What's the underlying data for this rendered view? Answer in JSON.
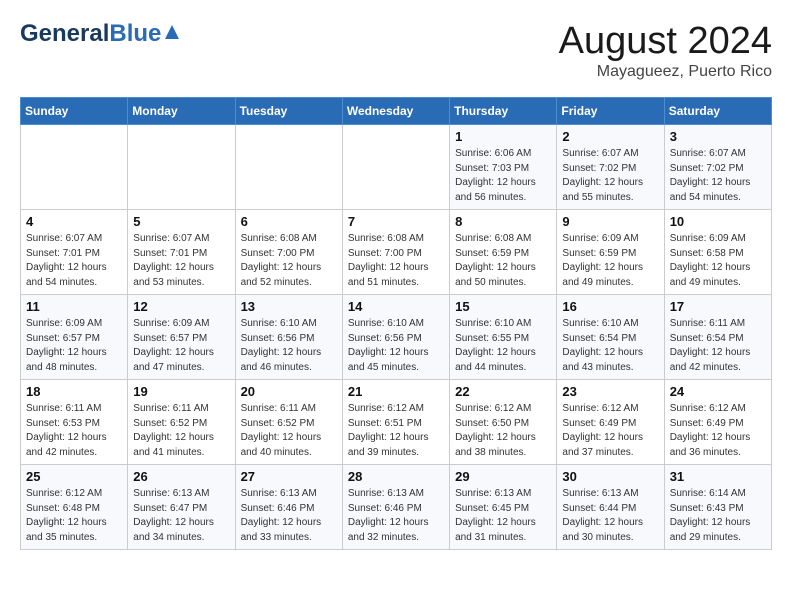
{
  "header": {
    "logo_general": "General",
    "logo_blue": "Blue",
    "month": "August 2024",
    "location": "Mayagueez, Puerto Rico"
  },
  "days_of_week": [
    "Sunday",
    "Monday",
    "Tuesday",
    "Wednesday",
    "Thursday",
    "Friday",
    "Saturday"
  ],
  "weeks": [
    [
      {
        "day": "",
        "info": ""
      },
      {
        "day": "",
        "info": ""
      },
      {
        "day": "",
        "info": ""
      },
      {
        "day": "",
        "info": ""
      },
      {
        "day": "1",
        "info": "Sunrise: 6:06 AM\nSunset: 7:03 PM\nDaylight: 12 hours\nand 56 minutes."
      },
      {
        "day": "2",
        "info": "Sunrise: 6:07 AM\nSunset: 7:02 PM\nDaylight: 12 hours\nand 55 minutes."
      },
      {
        "day": "3",
        "info": "Sunrise: 6:07 AM\nSunset: 7:02 PM\nDaylight: 12 hours\nand 54 minutes."
      }
    ],
    [
      {
        "day": "4",
        "info": "Sunrise: 6:07 AM\nSunset: 7:01 PM\nDaylight: 12 hours\nand 54 minutes."
      },
      {
        "day": "5",
        "info": "Sunrise: 6:07 AM\nSunset: 7:01 PM\nDaylight: 12 hours\nand 53 minutes."
      },
      {
        "day": "6",
        "info": "Sunrise: 6:08 AM\nSunset: 7:00 PM\nDaylight: 12 hours\nand 52 minutes."
      },
      {
        "day": "7",
        "info": "Sunrise: 6:08 AM\nSunset: 7:00 PM\nDaylight: 12 hours\nand 51 minutes."
      },
      {
        "day": "8",
        "info": "Sunrise: 6:08 AM\nSunset: 6:59 PM\nDaylight: 12 hours\nand 50 minutes."
      },
      {
        "day": "9",
        "info": "Sunrise: 6:09 AM\nSunset: 6:59 PM\nDaylight: 12 hours\nand 49 minutes."
      },
      {
        "day": "10",
        "info": "Sunrise: 6:09 AM\nSunset: 6:58 PM\nDaylight: 12 hours\nand 49 minutes."
      }
    ],
    [
      {
        "day": "11",
        "info": "Sunrise: 6:09 AM\nSunset: 6:57 PM\nDaylight: 12 hours\nand 48 minutes."
      },
      {
        "day": "12",
        "info": "Sunrise: 6:09 AM\nSunset: 6:57 PM\nDaylight: 12 hours\nand 47 minutes."
      },
      {
        "day": "13",
        "info": "Sunrise: 6:10 AM\nSunset: 6:56 PM\nDaylight: 12 hours\nand 46 minutes."
      },
      {
        "day": "14",
        "info": "Sunrise: 6:10 AM\nSunset: 6:56 PM\nDaylight: 12 hours\nand 45 minutes."
      },
      {
        "day": "15",
        "info": "Sunrise: 6:10 AM\nSunset: 6:55 PM\nDaylight: 12 hours\nand 44 minutes."
      },
      {
        "day": "16",
        "info": "Sunrise: 6:10 AM\nSunset: 6:54 PM\nDaylight: 12 hours\nand 43 minutes."
      },
      {
        "day": "17",
        "info": "Sunrise: 6:11 AM\nSunset: 6:54 PM\nDaylight: 12 hours\nand 42 minutes."
      }
    ],
    [
      {
        "day": "18",
        "info": "Sunrise: 6:11 AM\nSunset: 6:53 PM\nDaylight: 12 hours\nand 42 minutes."
      },
      {
        "day": "19",
        "info": "Sunrise: 6:11 AM\nSunset: 6:52 PM\nDaylight: 12 hours\nand 41 minutes."
      },
      {
        "day": "20",
        "info": "Sunrise: 6:11 AM\nSunset: 6:52 PM\nDaylight: 12 hours\nand 40 minutes."
      },
      {
        "day": "21",
        "info": "Sunrise: 6:12 AM\nSunset: 6:51 PM\nDaylight: 12 hours\nand 39 minutes."
      },
      {
        "day": "22",
        "info": "Sunrise: 6:12 AM\nSunset: 6:50 PM\nDaylight: 12 hours\nand 38 minutes."
      },
      {
        "day": "23",
        "info": "Sunrise: 6:12 AM\nSunset: 6:49 PM\nDaylight: 12 hours\nand 37 minutes."
      },
      {
        "day": "24",
        "info": "Sunrise: 6:12 AM\nSunset: 6:49 PM\nDaylight: 12 hours\nand 36 minutes."
      }
    ],
    [
      {
        "day": "25",
        "info": "Sunrise: 6:12 AM\nSunset: 6:48 PM\nDaylight: 12 hours\nand 35 minutes."
      },
      {
        "day": "26",
        "info": "Sunrise: 6:13 AM\nSunset: 6:47 PM\nDaylight: 12 hours\nand 34 minutes."
      },
      {
        "day": "27",
        "info": "Sunrise: 6:13 AM\nSunset: 6:46 PM\nDaylight: 12 hours\nand 33 minutes."
      },
      {
        "day": "28",
        "info": "Sunrise: 6:13 AM\nSunset: 6:46 PM\nDaylight: 12 hours\nand 32 minutes."
      },
      {
        "day": "29",
        "info": "Sunrise: 6:13 AM\nSunset: 6:45 PM\nDaylight: 12 hours\nand 31 minutes."
      },
      {
        "day": "30",
        "info": "Sunrise: 6:13 AM\nSunset: 6:44 PM\nDaylight: 12 hours\nand 30 minutes."
      },
      {
        "day": "31",
        "info": "Sunrise: 6:14 AM\nSunset: 6:43 PM\nDaylight: 12 hours\nand 29 minutes."
      }
    ]
  ]
}
